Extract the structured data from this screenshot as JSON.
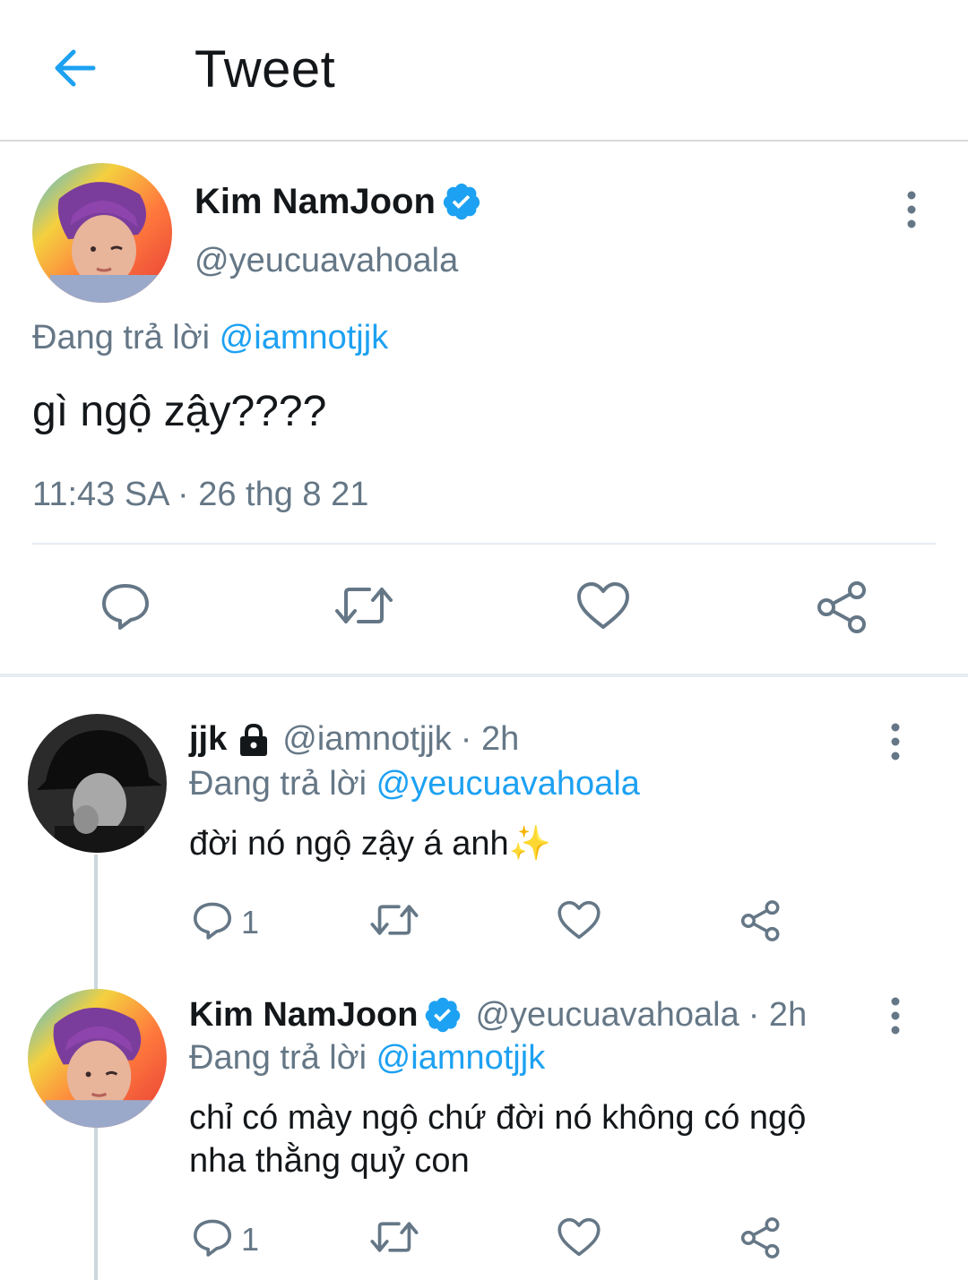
{
  "header": {
    "title": "Tweet",
    "back_icon": "arrow-left-icon",
    "accent_color": "#1da1f2"
  },
  "main_tweet": {
    "name": "Kim NamJoon",
    "verified": true,
    "handle": "@yeucuavahoala",
    "replying_prefix": "Đang trả lời",
    "replying_to": "@iamnotjjk",
    "text": "gì ngộ zậy????",
    "timestamp": "11:43 SA · 26 thg 8 21",
    "actions": [
      "reply-icon",
      "retweet-icon",
      "like-icon",
      "share-icon"
    ]
  },
  "replies": [
    {
      "name": "jjk",
      "protected": true,
      "handle": "@iamnotjjk",
      "time": "· 2h",
      "replying_prefix": "Đang trả lời",
      "replying_to": "@yeucuavahoala",
      "text": "đời nó ngộ zậy á anh",
      "emoji": "✨",
      "reply_count": "1"
    },
    {
      "name": "Kim NamJoon",
      "verified": true,
      "handle": "@yeucuavahoala",
      "time": "· 2h",
      "replying_prefix": "Đang trả lời",
      "replying_to": "@iamnotjjk",
      "text_line1": "chỉ có mày ngộ chứ đời nó không có ngộ",
      "text_line2": "nha thằng quỷ con",
      "reply_count": "1"
    }
  ]
}
